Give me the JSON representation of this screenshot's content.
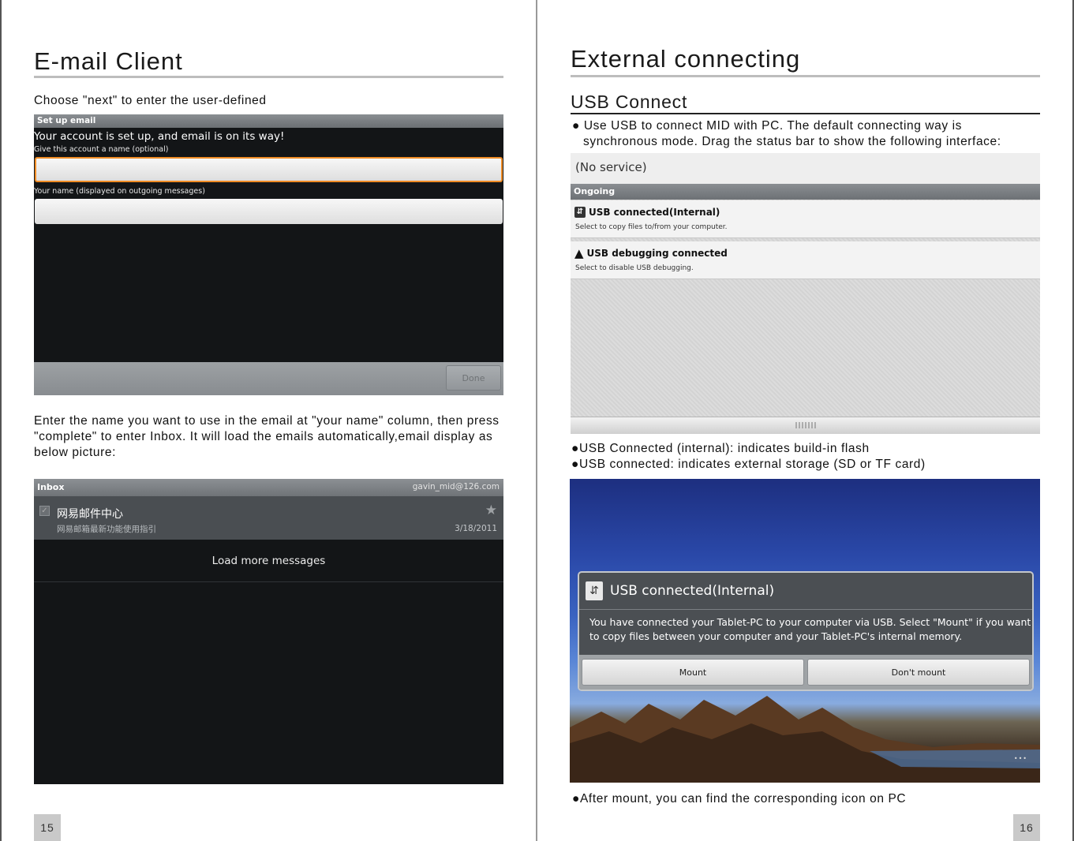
{
  "left_page": {
    "title": "E-mail Client",
    "intro": "Choose \"next\" to enter the user-defined",
    "setup_screen": {
      "titlebar": "Set up email",
      "headline": "Your account is set up, and email is on its way!",
      "account_name_label": "Give this account a name (optional)",
      "your_name_label": "Your name (displayed on outgoing messages)",
      "done_label": "Done"
    },
    "body": "Enter the name you want to use in the email at \"your name\" column, then press \"complete\" to enter Inbox. It will load the emails automatically,email display as below picture:",
    "inbox_screen": {
      "title": "Inbox",
      "account": "gavin_mid@126.com",
      "message": {
        "sender": "网易邮件中心",
        "subject": "网易邮箱最新功能使用指引",
        "date": "3/18/2011"
      },
      "load_more": "Load more messages"
    },
    "page_number": "15"
  },
  "right_page": {
    "title": "External connecting",
    "subtitle": "USB Connect",
    "bullet1_line1": "Use USB to connect MID with PC. The default connecting way is",
    "bullet1_line2": "synchronous mode. Drag the status bar to show the following interface:",
    "status_screen": {
      "no_service": "(No service)",
      "ongoing": "Ongoing",
      "notif1_title": "USB connected(Internal)",
      "notif1_sub": "Select to copy files to/from your computer.",
      "notif2_title": "USB debugging connected",
      "notif2_sub": "Select to disable USB debugging."
    },
    "bullet2": "USB Connected (internal): indicates build-in flash",
    "bullet3": "USB connected: indicates external storage (SD or TF card)",
    "mount_screen": {
      "title": "USB connected(Internal)",
      "body": "You have connected your Tablet-PC to your computer via USB. Select \"Mount\" if you want to copy files between your computer and your Tablet-PC's internal memory.",
      "mount_label": "Mount",
      "dont_mount_label": "Don't mount"
    },
    "bullet4": "After mount, you can find the corresponding icon on PC",
    "page_number": "16"
  },
  "icons": {
    "bullet": "black-circle",
    "usb": "usb-icon",
    "warning": "warning-icon",
    "star": "star-icon"
  },
  "colors": {
    "focus_orange": "#f08c25",
    "rule_gray": "#bdbdbd",
    "screen_dark": "#131517"
  }
}
